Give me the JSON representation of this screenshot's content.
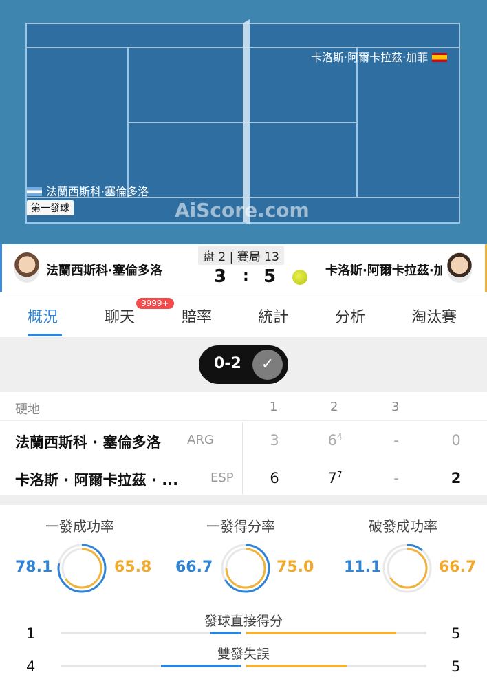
{
  "court": {
    "top_player": "卡洛斯·阿爾卡拉茲·加菲",
    "bottom_player": "法蘭西斯科·塞倫多洛",
    "serve_label": "第一發球",
    "watermark": "AiScore.com"
  },
  "header": {
    "left_name": "法蘭西斯科·塞倫多洛",
    "right_name": "卡洛斯·阿爾卡拉茲·加菲",
    "set_game": "盘 2 | 賽局 13",
    "score_left": "3",
    "score_colon": ":",
    "score_right": "5"
  },
  "tabs": {
    "items": [
      "概況",
      "聊天",
      "賠率",
      "統計",
      "分析",
      "淘汰賽"
    ],
    "active_index": 0,
    "chat_badge": "9999+"
  },
  "sets_toggle": {
    "label": "0-2",
    "check": "✓"
  },
  "score_table": {
    "surface": "硬地",
    "set_headers": [
      "1",
      "2",
      "3"
    ],
    "players": [
      {
        "name": "法蘭西斯科 · 塞倫多洛",
        "country": "ARG",
        "sets": [
          "3",
          "6",
          "-"
        ],
        "tiebreak2": "4",
        "total": "0"
      },
      {
        "name": "卡洛斯 · 阿爾卡拉茲 · ...",
        "country": "ESP",
        "sets": [
          "6",
          "7",
          "-"
        ],
        "tiebreak2": "7",
        "total": "2"
      }
    ]
  },
  "stats": {
    "rings": [
      {
        "title": "一發成功率",
        "left": "78.1",
        "right": "65.8",
        "left_value": 78.1,
        "right_value": 65.8
      },
      {
        "title": "一發得分率",
        "left": "66.7",
        "right": "75.0",
        "left_value": 66.7,
        "right_value": 75.0
      },
      {
        "title": "破發成功率",
        "left": "11.1",
        "right": "66.7",
        "left_value": 11.1,
        "right_value": 66.7
      }
    ],
    "bars": [
      {
        "title": "發球直接得分",
        "left": "1",
        "right": "5",
        "left_value": 1,
        "right_value": 5
      },
      {
        "title": "雙發失誤",
        "left": "4",
        "right": "5",
        "left_value": 4,
        "right_value": 5
      }
    ]
  },
  "colors": {
    "blue": "#2f84d8",
    "orange": "#f0b23b",
    "court": "#3e86b0"
  }
}
